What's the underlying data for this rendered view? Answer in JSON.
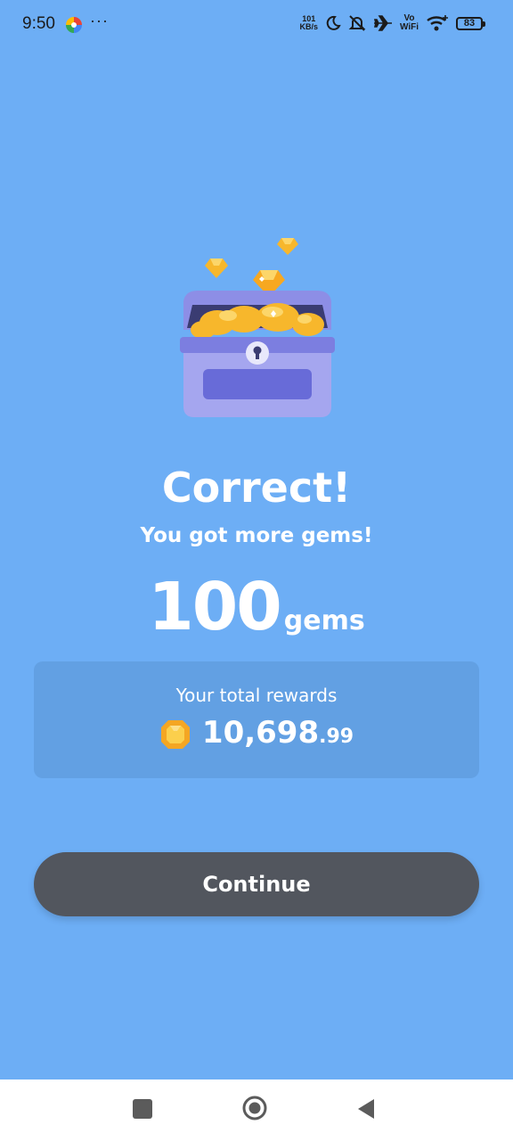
{
  "status_bar": {
    "time": "9:50",
    "more": "···",
    "net_speed_value": "101",
    "net_speed_unit": "KB/s",
    "vowifi_top": "Vo",
    "vowifi_bottom": "WiFi",
    "battery": "83"
  },
  "result": {
    "title": "Correct!",
    "subtitle": "You got more gems!",
    "amount": "100",
    "amount_unit": "gems"
  },
  "rewards": {
    "label": "Your total rewards",
    "value": "10,698",
    "decimal": ".99"
  },
  "actions": {
    "continue_label": "Continue"
  },
  "colors": {
    "background": "#6daef5",
    "card": "#62a0e3",
    "button": "#52565e",
    "gem": "#f7b72c"
  }
}
